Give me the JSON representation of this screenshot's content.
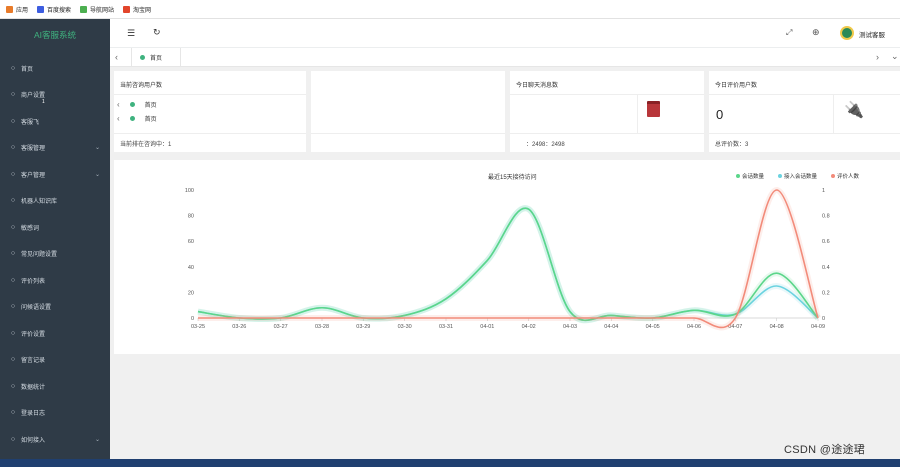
{
  "bookmarks": [
    {
      "label": "应用",
      "icon": "grid-icon",
      "color": "#e87b2a"
    },
    {
      "label": "百度搜索",
      "icon": "baidu-icon",
      "color": "#3d5de0"
    },
    {
      "label": "导航网站",
      "icon": "check-icon",
      "color": "#4caf50"
    },
    {
      "label": "淘宝网",
      "icon": "taobao-icon",
      "color": "#e2452b"
    }
  ],
  "sidebar": {
    "title": "AI客服系统",
    "items": [
      {
        "label": "首页",
        "icon": "home-icon",
        "arrow": false
      },
      {
        "label": "商户设置",
        "icon": "gear-icon",
        "arrow": false
      },
      {
        "label": "客服飞",
        "icon": "headset-icon",
        "arrow": false
      },
      {
        "label": "客服管理",
        "icon": "user-icon",
        "arrow": true
      },
      {
        "label": "客户管理",
        "icon": "users-icon",
        "arrow": true
      },
      {
        "label": "机器人知识库",
        "icon": "robot-icon",
        "arrow": false
      },
      {
        "label": "敏感词",
        "icon": "shield-icon",
        "arrow": false
      },
      {
        "label": "常见问题设置",
        "icon": "question-icon",
        "arrow": false
      },
      {
        "label": "评价列表",
        "icon": "star-icon",
        "arrow": false
      },
      {
        "label": "问候语设置",
        "icon": "chat-icon",
        "arrow": false
      },
      {
        "label": "评价设置",
        "icon": "edit-icon",
        "arrow": false
      },
      {
        "label": "留言记录",
        "icon": "note-icon",
        "arrow": false
      },
      {
        "label": "数据统计",
        "icon": "chart-icon",
        "arrow": false
      },
      {
        "label": "登录日志",
        "icon": "log-icon",
        "arrow": false
      },
      {
        "label": "如何接入",
        "icon": "plug-icon",
        "arrow": true
      }
    ],
    "dot": "1"
  },
  "topbar": {
    "user": "测试客服"
  },
  "tabs": {
    "active": "首页"
  },
  "dropdown": [
    {
      "label": "首页"
    },
    {
      "label": "首页"
    }
  ],
  "cards": [
    {
      "title": "当前咨询用户数",
      "footer": "当前排在咨询中：1",
      "value": ""
    },
    {
      "title": "",
      "footer": "",
      "value": ""
    },
    {
      "title": "今日聊天消息数",
      "footer": "：2498：2498",
      "value": ""
    },
    {
      "title": "今日评价用户数",
      "footer": "总评价数：3",
      "value": "0"
    }
  ],
  "chart_data": {
    "type": "line",
    "title": "最近15天接待访问",
    "categories": [
      "03-25",
      "03-26",
      "03-27",
      "03-28",
      "03-29",
      "03-30",
      "03-31",
      "04-01",
      "04-02",
      "04-03",
      "04-04",
      "04-05",
      "04-06",
      "04-07",
      "04-08",
      "04-09"
    ],
    "series": [
      {
        "name": "会话数量",
        "color": "#5bd68a",
        "values": [
          5,
          0,
          0,
          8,
          0,
          2,
          15,
          45,
          85,
          5,
          2,
          0,
          6,
          3,
          35,
          0
        ]
      },
      {
        "name": "接入会话数量",
        "color": "#6bd3e0",
        "values": [
          5,
          0,
          0,
          8,
          0,
          2,
          15,
          45,
          85,
          5,
          2,
          0,
          6,
          3,
          25,
          0
        ]
      },
      {
        "name": "评价人数",
        "color": "#f28b7a",
        "values": [
          0,
          0,
          0,
          0,
          0,
          0,
          0,
          0,
          0,
          0,
          0,
          0,
          0,
          0,
          1,
          0
        ]
      }
    ],
    "y_left": {
      "ylim": [
        0,
        100
      ],
      "ticks": [
        "0",
        "20",
        "40",
        "60",
        "80",
        "100"
      ]
    },
    "y_right": {
      "ylim": [
        0,
        1
      ],
      "ticks": [
        "0",
        "0.2",
        "0.4",
        "0.6",
        "0.8",
        "1"
      ]
    },
    "legend": "top-right",
    "grid": false
  },
  "watermark": "CSDN @途途珺"
}
